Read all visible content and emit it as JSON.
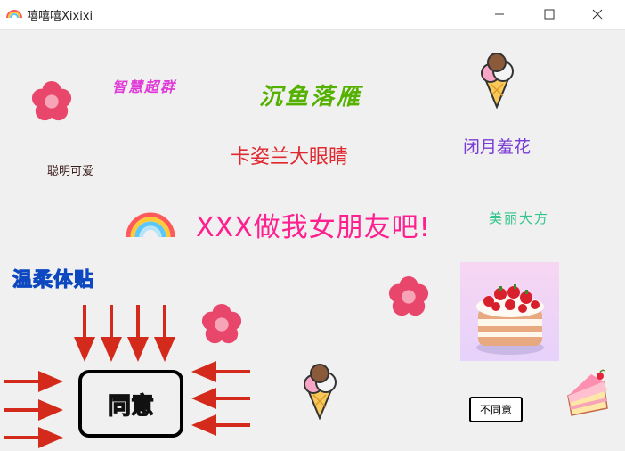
{
  "window": {
    "title": "嘻嘻嘻Xixixi",
    "controls": [
      "minimize",
      "maximize",
      "close"
    ]
  },
  "labels": {
    "zhihui": "智慧超群",
    "chenyu": "沉鱼落雁",
    "biyue": "闭月羞花",
    "kazi": "卡姿兰大眼睛",
    "congming": "聪明可爱",
    "meili": "美丽大方",
    "main": "XXX做我女朋友吧!",
    "wenrou": "温柔体贴"
  },
  "buttons": {
    "agree": "同意",
    "disagree": "不同意"
  },
  "decorations": [
    "flower-icon",
    "ice-cream-icon",
    "rainbow-icon",
    "cake-image",
    "cake-slice-icon",
    "arrow-icon"
  ],
  "colors": {
    "main_text": "#ff1f8e",
    "flower": "#e8476b",
    "arrow": "#d32a1c"
  }
}
